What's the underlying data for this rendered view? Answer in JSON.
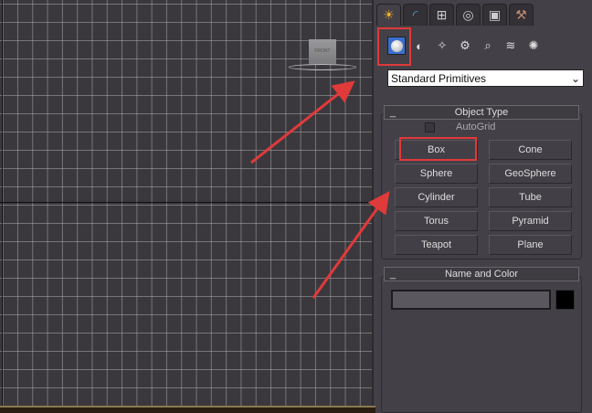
{
  "viewport": {
    "viewcube_label": "FRONT"
  },
  "tabs": [
    {
      "name": "create",
      "icon": "☀"
    },
    {
      "name": "modify",
      "icon": "◜"
    },
    {
      "name": "hierarchy",
      "icon": "⊞"
    },
    {
      "name": "motion",
      "icon": "◎"
    },
    {
      "name": "display",
      "icon": "▣"
    },
    {
      "name": "utilities",
      "icon": "⚒"
    }
  ],
  "subcategories": [
    {
      "name": "geometry",
      "icon": ""
    },
    {
      "name": "shapes",
      "icon": "◐"
    },
    {
      "name": "lights",
      "icon": "✧"
    },
    {
      "name": "cameras",
      "icon": "⚙"
    },
    {
      "name": "helpers",
      "icon": "⌕"
    },
    {
      "name": "space-warps",
      "icon": "≋"
    },
    {
      "name": "systems",
      "icon": "✺"
    }
  ],
  "dropdown": {
    "value": "Standard Primitives",
    "arrow": "⌄"
  },
  "object_type": {
    "title": "Object Type",
    "collapse": "_",
    "autogrid": "AutoGrid",
    "buttons": [
      "Box",
      "Cone",
      "Sphere",
      "GeoSphere",
      "Cylinder",
      "Tube",
      "Torus",
      "Pyramid",
      "Teapot",
      "Plane"
    ]
  },
  "name_color": {
    "title": "Name and Color",
    "collapse": "_",
    "name_value": "",
    "color": "#000000"
  },
  "annotation_color": "#e03a3a"
}
